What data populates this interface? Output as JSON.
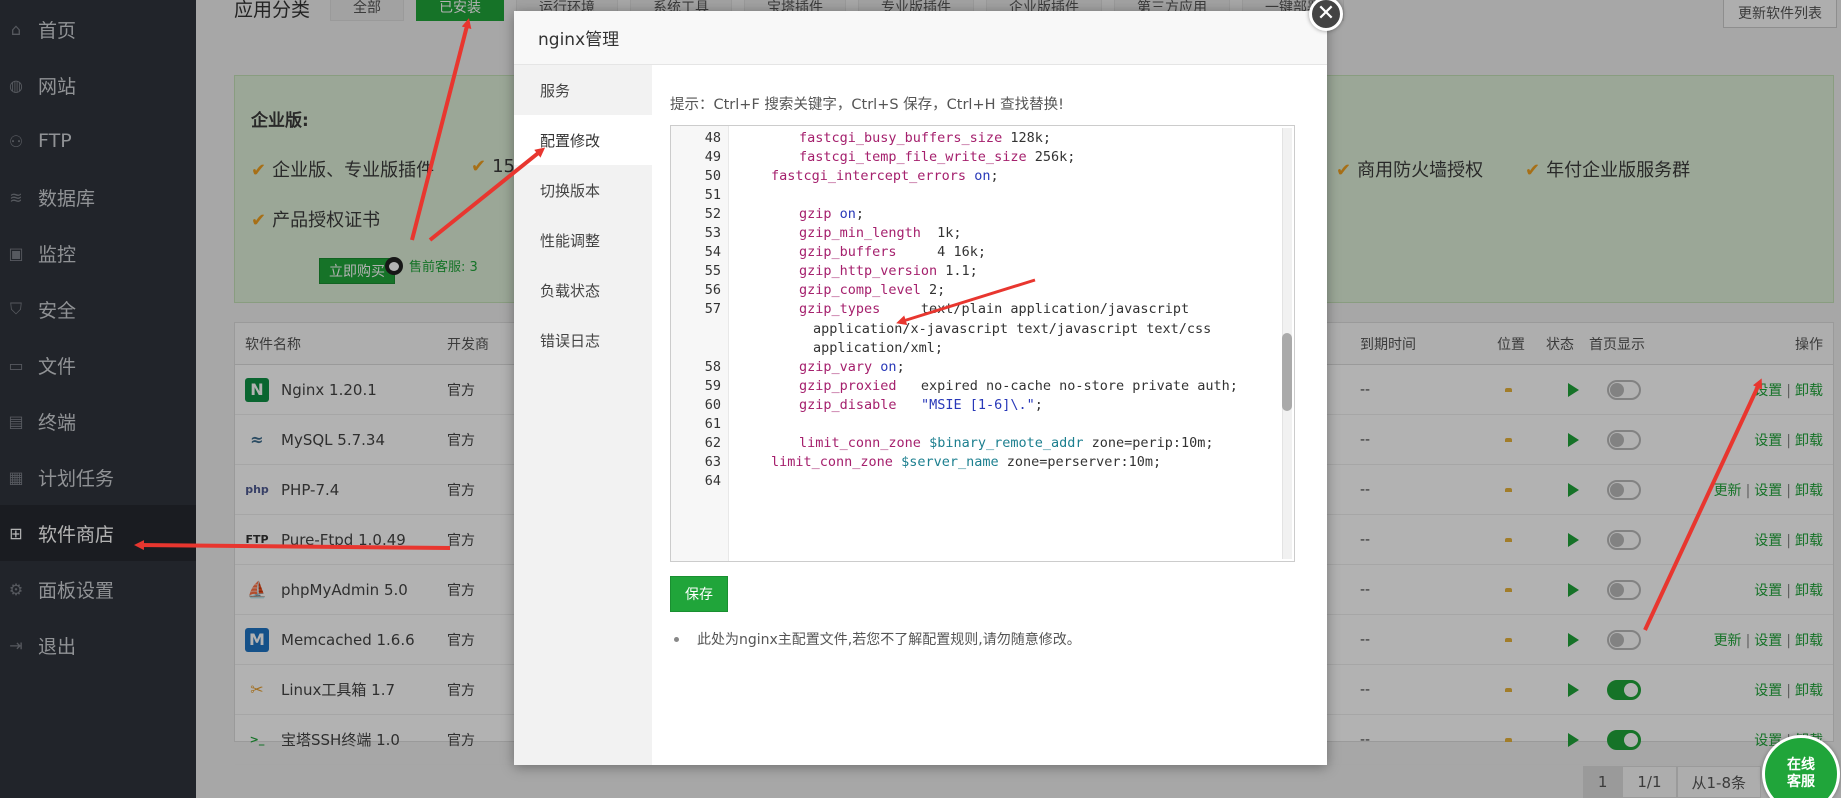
{
  "sidebar": {
    "items": [
      {
        "label": "首页",
        "icon": "home-icon"
      },
      {
        "label": "网站",
        "icon": "globe-icon"
      },
      {
        "label": "FTP",
        "icon": "ftp-icon"
      },
      {
        "label": "数据库",
        "icon": "database-icon"
      },
      {
        "label": "监控",
        "icon": "monitor-icon"
      },
      {
        "label": "安全",
        "icon": "shield-icon"
      },
      {
        "label": "文件",
        "icon": "folder-icon"
      },
      {
        "label": "终端",
        "icon": "terminal-icon"
      },
      {
        "label": "计划任务",
        "icon": "calendar-icon"
      },
      {
        "label": "软件商店",
        "icon": "grid-icon"
      },
      {
        "label": "面板设置",
        "icon": "gear-icon"
      },
      {
        "label": "退出",
        "icon": "logout-icon"
      }
    ],
    "active_index": 9
  },
  "topbar": {
    "label": "应用分类",
    "categories": [
      "全部",
      "已安装",
      "运行环境",
      "系统工具",
      "宝塔插件",
      "专业版插件",
      "企业版插件",
      "第三方应用",
      "一键部署"
    ],
    "active_index": 1,
    "update_list": "更新软件列表"
  },
  "enterprise": {
    "title": "企业版:",
    "features_row1": [
      "企业版、专业版插件",
      "15",
      "商用防火墙授权",
      "年付企业版服务群"
    ],
    "features_row2": [
      "产品授权证书"
    ],
    "buy_label": "立即购买",
    "service_label": "售前客服: 3"
  },
  "table": {
    "headers": {
      "name": "软件名称",
      "dev": "开发商",
      "expire": "到期时间",
      "position": "位置",
      "status": "状态",
      "home": "首页显示",
      "ops": "操作"
    },
    "rows": [
      {
        "name": "Nginx 1.20.1",
        "dev": "官方",
        "expire": "--",
        "home_on": false,
        "ops": [
          "设置",
          "卸载"
        ],
        "icon": "nginx-icon"
      },
      {
        "name": "MySQL 5.7.34",
        "dev": "官方",
        "expire": "--",
        "home_on": false,
        "ops": [
          "设置",
          "卸载"
        ],
        "icon": "mysql-icon"
      },
      {
        "name": "PHP-7.4",
        "dev": "官方",
        "expire": "--",
        "home_on": false,
        "ops": [
          "更新",
          "设置",
          "卸载"
        ],
        "icon": "php-icon"
      },
      {
        "name": "Pure-Ftpd 1.0.49",
        "dev": "官方",
        "expire": "--",
        "home_on": false,
        "ops": [
          "设置",
          "卸载"
        ],
        "icon": "ftp-app-icon"
      },
      {
        "name": "phpMyAdmin 5.0",
        "dev": "官方",
        "expire": "--",
        "home_on": false,
        "ops": [
          "设置",
          "卸载"
        ],
        "icon": "phpmyadmin-icon"
      },
      {
        "name": "Memcached 1.6.6",
        "dev": "官方",
        "expire": "--",
        "home_on": false,
        "ops": [
          "更新",
          "设置",
          "卸载"
        ],
        "icon": "memcached-icon"
      },
      {
        "name": "Linux工具箱 1.7",
        "dev": "官方",
        "expire": "--",
        "home_on": true,
        "ops": [
          "设置",
          "卸载"
        ],
        "icon": "toolbox-icon"
      },
      {
        "name": "宝塔SSH终端 1.0",
        "dev": "官方",
        "expire": "--",
        "home_on": true,
        "ops": [
          "设置",
          "卸载"
        ],
        "icon": "ssh-terminal-icon"
      }
    ]
  },
  "pager": {
    "current": "1",
    "total": "1/1",
    "range": "从1-8条"
  },
  "online": {
    "line1": "在线",
    "line2": "客服"
  },
  "modal": {
    "title": "nginx管理",
    "nav": [
      "服务",
      "配置修改",
      "切换版本",
      "性能调整",
      "负载状态",
      "错误日志"
    ],
    "active_nav": 1,
    "tip": "提示：Ctrl+F 搜索关键字，Ctrl+S 保存，Ctrl+H 查找替换!",
    "save_label": "保存",
    "note": "此处为nginx主配置文件,若您不了解配置规则,请勿随意修改。",
    "code_lines": [
      {
        "n": "48",
        "indent": 2,
        "parts": [
          [
            "kw",
            "fastcgi_busy_buffers_size"
          ],
          [
            "val",
            " 128k;"
          ]
        ]
      },
      {
        "n": "49",
        "indent": 2,
        "parts": [
          [
            "kw",
            "fastcgi_temp_file_write_size"
          ],
          [
            "val",
            " 256k;"
          ]
        ]
      },
      {
        "n": "50",
        "indent": 1,
        "parts": [
          [
            "kw",
            "fastcgi_intercept_errors"
          ],
          [
            "val",
            " "
          ],
          [
            "on-kw",
            "on"
          ],
          [
            "val",
            ";"
          ]
        ]
      },
      {
        "n": "51",
        "indent": 0,
        "parts": []
      },
      {
        "n": "52",
        "indent": 2,
        "parts": [
          [
            "kw",
            "gzip"
          ],
          [
            "val",
            " "
          ],
          [
            "on-kw",
            "on"
          ],
          [
            "val",
            ";"
          ]
        ]
      },
      {
        "n": "53",
        "indent": 2,
        "parts": [
          [
            "kw",
            "gzip_min_length"
          ],
          [
            "val",
            "  1k;"
          ]
        ]
      },
      {
        "n": "54",
        "indent": 2,
        "parts": [
          [
            "kw",
            "gzip_buffers"
          ],
          [
            "val",
            "     4 16k;"
          ]
        ]
      },
      {
        "n": "55",
        "indent": 2,
        "parts": [
          [
            "kw",
            "gzip_http_version"
          ],
          [
            "val",
            " 1.1;"
          ]
        ]
      },
      {
        "n": "56",
        "indent": 2,
        "parts": [
          [
            "kw",
            "gzip_comp_level"
          ],
          [
            "val",
            " 2;"
          ]
        ]
      },
      {
        "n": "57",
        "indent": 2,
        "parts": [
          [
            "kw",
            "gzip_types"
          ],
          [
            "val",
            "     text/plain application/javascript"
          ]
        ]
      },
      {
        "n": "",
        "indent": 3,
        "parts": [
          [
            "val",
            "application/x-javascript text/javascript text/css"
          ]
        ]
      },
      {
        "n": "",
        "indent": 3,
        "parts": [
          [
            "val",
            "application/xml;"
          ]
        ]
      },
      {
        "n": "58",
        "indent": 2,
        "parts": [
          [
            "kw",
            "gzip_vary"
          ],
          [
            "val",
            " "
          ],
          [
            "on-kw",
            "on"
          ],
          [
            "val",
            ";"
          ]
        ]
      },
      {
        "n": "59",
        "indent": 2,
        "parts": [
          [
            "kw",
            "gzip_proxied"
          ],
          [
            "val",
            "   expired no-cache no-store private auth;"
          ]
        ]
      },
      {
        "n": "60",
        "indent": 2,
        "parts": [
          [
            "kw",
            "gzip_disable"
          ],
          [
            "val",
            "   "
          ],
          [
            "str",
            "\"MSIE [1-6]\\.\""
          ],
          [
            "val",
            ";"
          ]
        ]
      },
      {
        "n": "61",
        "indent": 0,
        "parts": []
      },
      {
        "n": "62",
        "indent": 2,
        "parts": [
          [
            "kw",
            "limit_conn_zone"
          ],
          [
            "val",
            " "
          ],
          [
            "var",
            "$binary_remote_addr"
          ],
          [
            "val",
            " zone=perip:10m;"
          ]
        ]
      },
      {
        "n": "63",
        "indent": 1,
        "parts": [
          [
            "kw",
            "limit_conn_zone"
          ],
          [
            "val",
            " "
          ],
          [
            "var",
            "$server_name"
          ],
          [
            "val",
            " zone=perserver:10m;"
          ]
        ]
      },
      {
        "n": "64",
        "indent": 0,
        "parts": []
      }
    ]
  },
  "colors": {
    "accent": "#20a53a",
    "sidebar": "#30343d",
    "arrow": "#e8362f"
  }
}
